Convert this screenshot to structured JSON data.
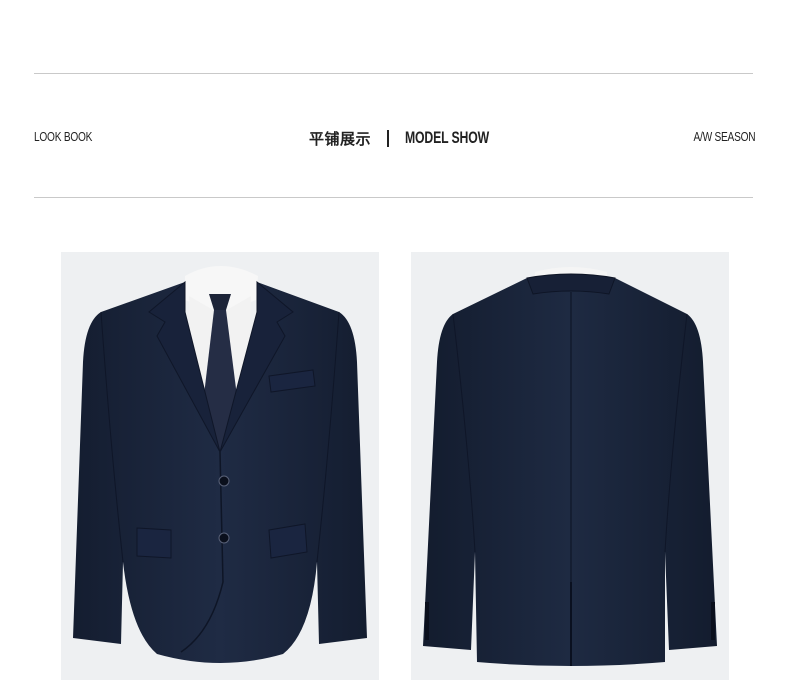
{
  "header": {
    "left_label": "LOOK BOOK",
    "center_cn": "平铺展示",
    "center_en": "MODEL SHOW",
    "right_label": "A/W SEASON"
  },
  "photos": [
    {
      "view": "front",
      "icon": "suit-jacket-front"
    },
    {
      "view": "back",
      "icon": "suit-jacket-back"
    }
  ],
  "colors": {
    "jacket": "#1c2840",
    "background": "#eef0f2",
    "rule": "#c9c9c9",
    "text": "#222222"
  }
}
